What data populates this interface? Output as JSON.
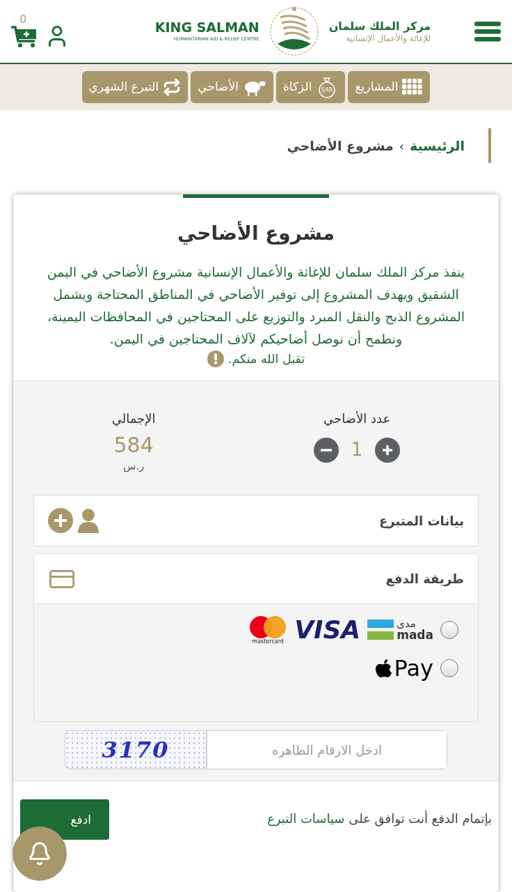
{
  "header": {
    "cart_count": "0",
    "logo": {
      "en_title": "KING SALMAN",
      "en_subtitle": "HUMANITARIAN AID & RELIEF CENTRE",
      "ar_title": "مركز الملك سلمان",
      "ar_subtitle": "للإغاثة والأعمال الإنسانية"
    }
  },
  "nav": [
    {
      "label": "المشاريع",
      "kind": "grid"
    },
    {
      "label": "الزكاة",
      "kind": "bag",
      "icon_label": "SAR"
    },
    {
      "label": "الأضاحي",
      "kind": "sheep"
    },
    {
      "label": "التبرع الشهري",
      "kind": "repeat"
    }
  ],
  "breadcrumb": {
    "separator": "›",
    "items": [
      {
        "label": "الرئيسية",
        "kind": "link"
      },
      {
        "label": "مشروع الأضاحي",
        "kind": "current"
      }
    ]
  },
  "project": {
    "title": "مشروع الأضاحي",
    "description": "ينفذ مركز الملك سلمان للإغاثة والأعمال الإنسانية مشروع الأضاحي في اليمن الشقيق ويهدف المشروع إلى توفير الأضاحي في المناطق المحتاجة ويشمل المشروع الذبح والنقل المبرد والتوزيع على المحتاجين في المحافظات اليمينة، ونطمح أن نوصل أضاحيكم لآلاف المحتاجين في اليمن.",
    "closing": "تقبل الله منكم."
  },
  "counter": {
    "label": "عدد الأضاحي",
    "value": "1"
  },
  "total": {
    "label": "الإجمالي",
    "amount": "584",
    "currency": "ر.س"
  },
  "donor_section": {
    "title": "بيانات المتبرع"
  },
  "payment": {
    "title": "طريقة الدفع",
    "options": [
      {
        "kind": "cards",
        "selected": false,
        "mada_ar": "مدى",
        "mada_en": "mada",
        "visa": "VISA",
        "mastercard": "mastercard"
      },
      {
        "kind": "applepay",
        "selected": false,
        "label": "Pay"
      }
    ]
  },
  "captcha": {
    "code": "3170",
    "placeholder": "ادخل الارقام الظاهره"
  },
  "footer": {
    "terms_prefix": "بإتمام الدفع أنت توافق على",
    "terms_link": "سياسات التبرع",
    "pay_button": "ادفع"
  }
}
